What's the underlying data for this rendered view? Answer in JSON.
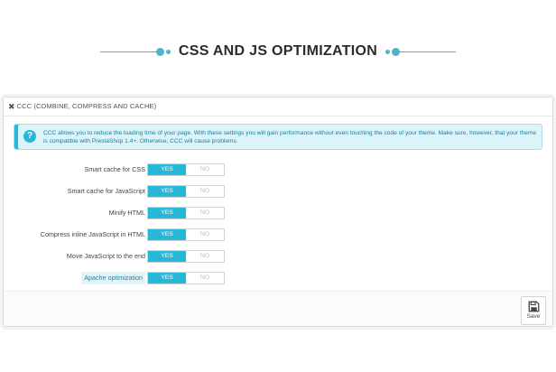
{
  "banner": {
    "title": "CSS AND JS OPTIMIZATION",
    "accent_color": "#4fb3c9"
  },
  "panel": {
    "heading_icon": "arrows-collapse-icon",
    "heading": "CCC (COMBINE, COMPRESS AND CACHE)",
    "info": {
      "icon": "question-icon",
      "text": "CCC allows you to reduce the loading time of your page. With these settings you will gain performance without even touching the code of your theme. Make sure, however, that your theme is compatible with PrestaShop 1.4+. Otherwise, CCC will cause problems."
    },
    "settings": [
      {
        "label": "Smart cache for CSS",
        "yes": "YES",
        "no": "NO",
        "value": "yes"
      },
      {
        "label": "Smart cache for JavaScript",
        "yes": "YES",
        "no": "NO",
        "value": "yes"
      },
      {
        "label": "Minify HTML",
        "yes": "YES",
        "no": "NO",
        "value": "yes"
      },
      {
        "label": "Compress inline JavaScript in HTML",
        "yes": "YES",
        "no": "NO",
        "value": "yes"
      },
      {
        "label": "Move JavaScript to the end",
        "yes": "YES",
        "no": "NO",
        "value": "yes"
      },
      {
        "label": "Apache optimization",
        "yes": "YES",
        "no": "NO",
        "value": "yes"
      }
    ],
    "switch_on_color": "#25b9d7",
    "save": {
      "icon": "floppy-disk-icon",
      "label": "Save"
    }
  }
}
